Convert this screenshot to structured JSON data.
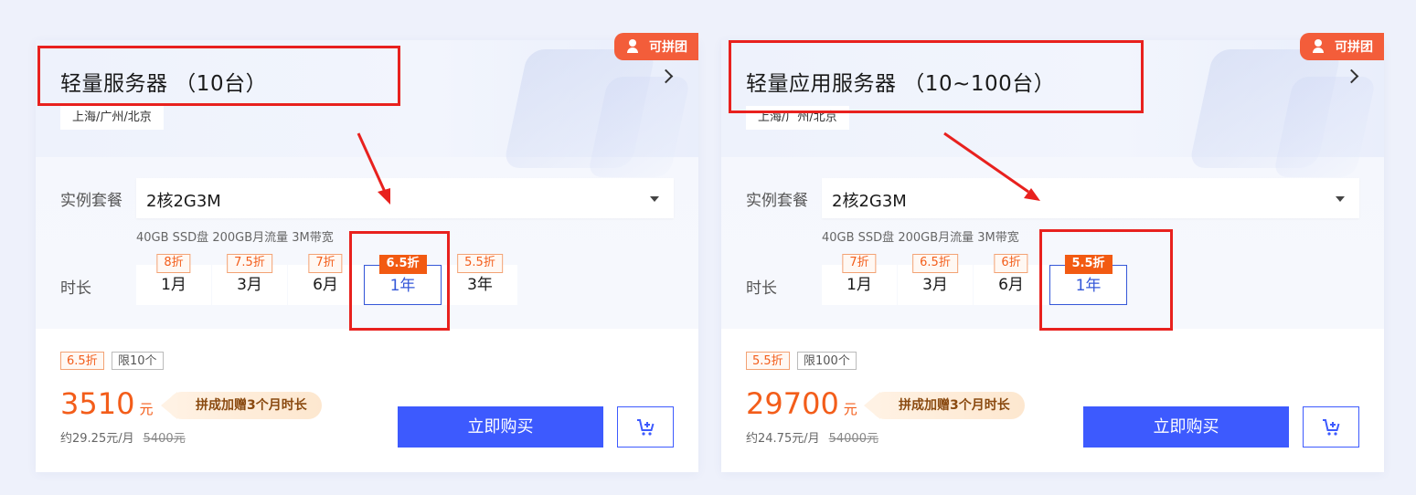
{
  "colors": {
    "accent": "#3d5afe",
    "discount": "#f35d1a",
    "annotation": "#e8211e",
    "badge": "#f35d3a"
  },
  "cards": [
    {
      "badge": "可拼团",
      "title": "轻量服务器 （10台）",
      "region": "上海/广州/北京",
      "package_label": "实例套餐",
      "package_value": "2核2G3M",
      "spec": "40GB SSD盘 200GB月流量 3M带宽",
      "duration_label": "时长",
      "durations": [
        {
          "label": "1月",
          "tag": "8折"
        },
        {
          "label": "3月",
          "tag": "7.5折"
        },
        {
          "label": "6月",
          "tag": "7折"
        },
        {
          "label": "1年",
          "tag": "6.5折",
          "selected": true
        },
        {
          "label": "3年",
          "tag": "5.5折"
        }
      ],
      "discount_pill": "6.5折",
      "limit_pill": "限10个",
      "price": "3510",
      "price_unit": "元",
      "promo": "拼成加赠3个月时长",
      "monthly": "约29.25元/月",
      "original_price": "5400元",
      "buy_label": "立即购买",
      "cart_icon": "cart-add-icon"
    },
    {
      "badge": "可拼团",
      "title": "轻量应用服务器 （10~100台）",
      "region": "上海/广州/北京",
      "package_label": "实例套餐",
      "package_value": "2核2G3M",
      "spec": "40GB SSD盘 200GB月流量 3M带宽",
      "duration_label": "时长",
      "durations": [
        {
          "label": "1月",
          "tag": "7折"
        },
        {
          "label": "3月",
          "tag": "6.5折"
        },
        {
          "label": "6月",
          "tag": "6折"
        },
        {
          "label": "1年",
          "tag": "5.5折",
          "selected": true
        }
      ],
      "discount_pill": "5.5折",
      "limit_pill": "限100个",
      "price": "29700",
      "price_unit": "元",
      "promo": "拼成加赠3个月时长",
      "monthly": "约24.75元/月",
      "original_price": "54000元",
      "buy_label": "立即购买",
      "cart_icon": "cart-add-icon"
    }
  ]
}
